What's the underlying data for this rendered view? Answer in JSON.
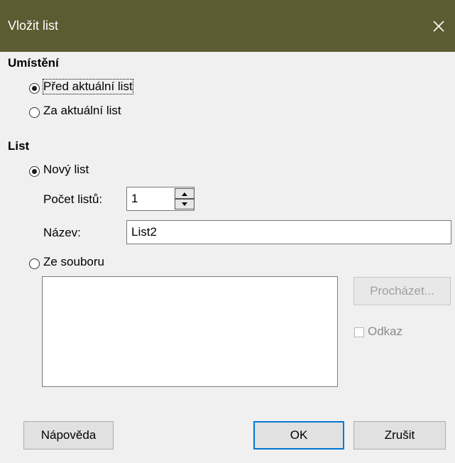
{
  "window": {
    "title": "Vložit list"
  },
  "placement": {
    "heading": "Umístění",
    "before_label": "Před aktuální list",
    "after_label": "Za aktuální list"
  },
  "sheet": {
    "heading": "List",
    "new_sheet_label": "Nový list",
    "count_label": "Počet listů:",
    "count_value": "1",
    "name_label": "Název:",
    "name_value": "List2",
    "from_file_label": "Ze souboru",
    "browse_label": "Procházet...",
    "link_label": "Odkaz"
  },
  "buttons": {
    "help": "Nápověda",
    "ok": "OK",
    "cancel": "Zrušit"
  },
  "colors": {
    "titlebar": "#5c5b32",
    "default_button_border": "#0078d7"
  }
}
